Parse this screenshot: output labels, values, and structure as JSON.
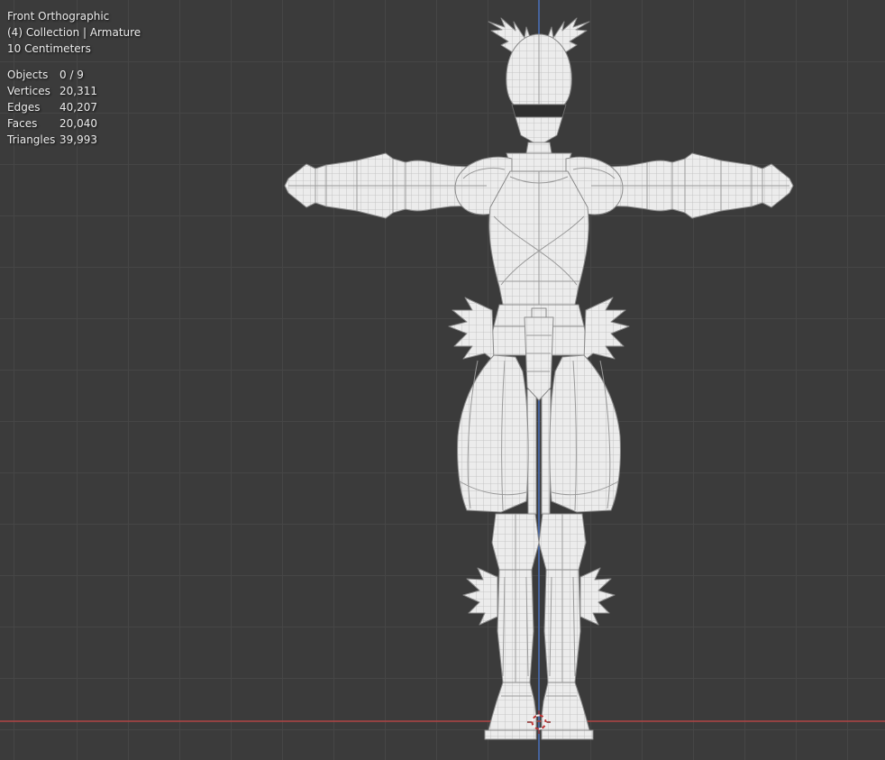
{
  "hud": {
    "view": "Front Orthographic",
    "collection": "(4) Collection | Armature",
    "scale": "10 Centimeters",
    "stats": [
      {
        "label": "Objects",
        "value": "0 / 9"
      },
      {
        "label": "Vertices",
        "value": "20,311"
      },
      {
        "label": "Edges",
        "value": "40,207"
      },
      {
        "label": "Faces",
        "value": "20,040"
      },
      {
        "label": "Triangles",
        "value": "39,993"
      }
    ]
  },
  "viewport": {
    "model_description": "armored knight character in T-pose shown as light wireframe mesh, winged helmet, winged hip and knee guards",
    "colors": {
      "background": "#3b3b3b",
      "grid_line": "#464646",
      "axis_z_vertical": "#46639c",
      "axis_x_horizontal": "#9e4444",
      "wireframe_fill": "#ececec",
      "wireframe_line": "#8a8a8a",
      "hud_text": "#ededed",
      "cursor_red": "#c03434",
      "cursor_white": "#f5f5f5"
    }
  }
}
